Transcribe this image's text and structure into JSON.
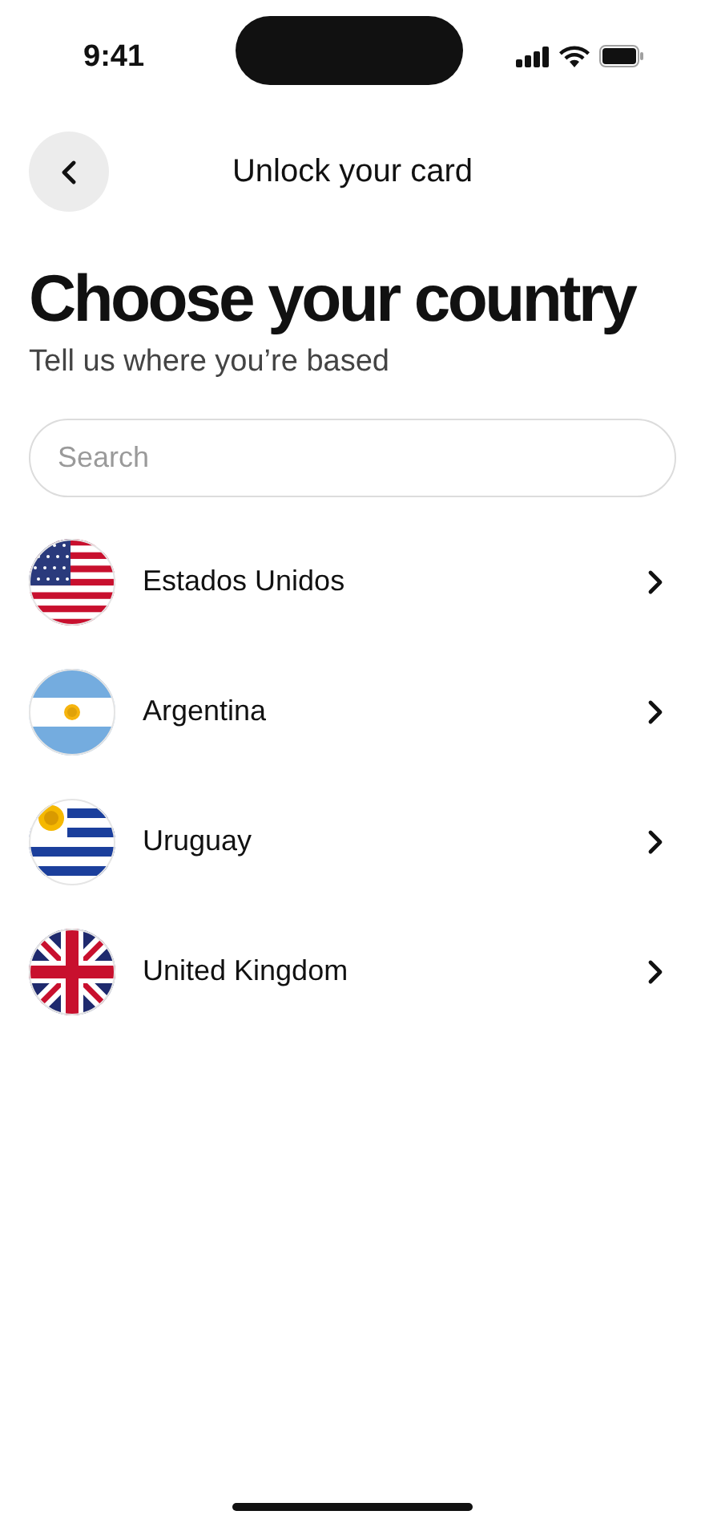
{
  "status_bar": {
    "time": "9:41"
  },
  "header": {
    "title": "Unlock your card"
  },
  "heading": "Choose your country",
  "subtitle": "Tell us where you’re based",
  "search": {
    "placeholder": "Search"
  },
  "countries": [
    {
      "name": "Estados Unidos"
    },
    {
      "name": "Argentina"
    },
    {
      "name": "Uruguay"
    },
    {
      "name": "United Kingdom"
    }
  ]
}
